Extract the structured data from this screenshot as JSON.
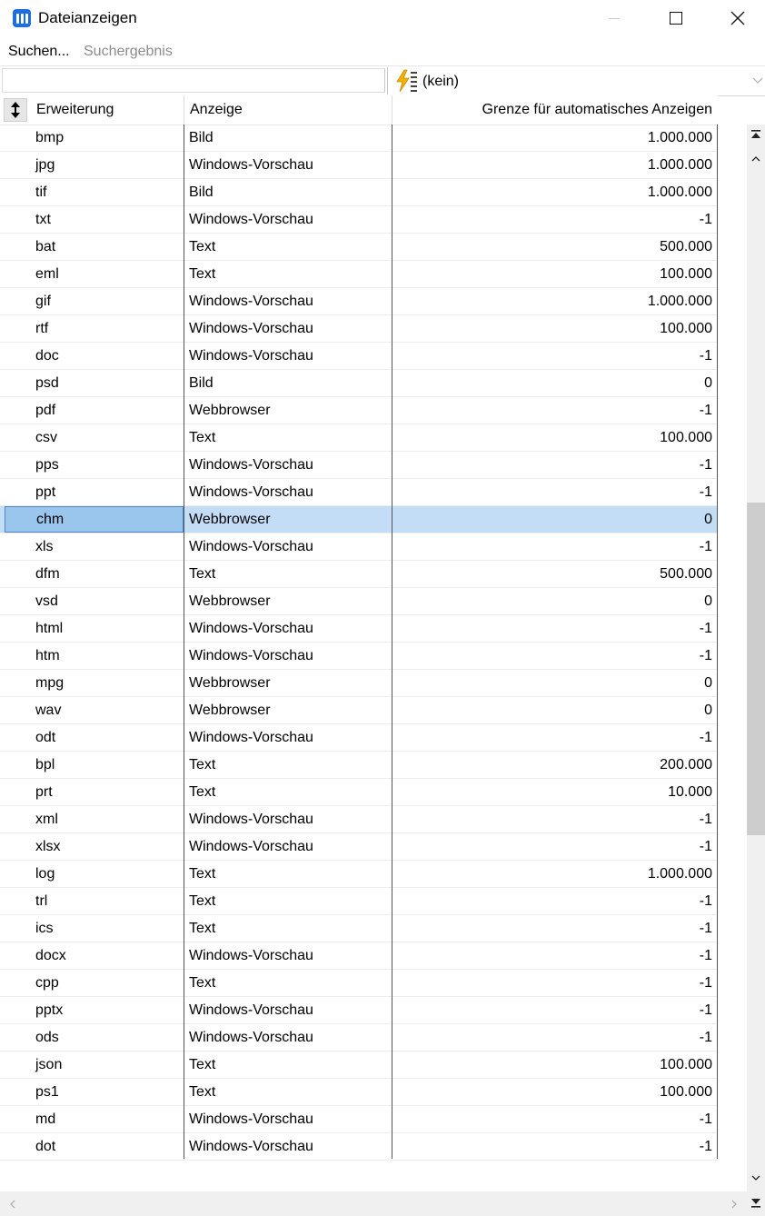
{
  "window": {
    "title": "Dateianzeigen"
  },
  "menu": {
    "search_label": "Suchen...",
    "results_label": "Suchergebnis"
  },
  "filter": {
    "input_value": "",
    "combo_value": "(kein)",
    "combo_icon": "lightning-list-icon"
  },
  "table": {
    "columns": {
      "extension": "Erweiterung",
      "view": "Anzeige",
      "limit": "Grenze für automatisches Anzeigen"
    },
    "selected_index": 14,
    "rows": [
      {
        "ext": "bmp",
        "view": "Bild",
        "limit": "1.000.000"
      },
      {
        "ext": "jpg",
        "view": "Windows-Vorschau",
        "limit": "1.000.000"
      },
      {
        "ext": "tif",
        "view": "Bild",
        "limit": "1.000.000"
      },
      {
        "ext": "txt",
        "view": "Windows-Vorschau",
        "limit": "-1"
      },
      {
        "ext": "bat",
        "view": "Text",
        "limit": "500.000"
      },
      {
        "ext": "eml",
        "view": "Text",
        "limit": "100.000"
      },
      {
        "ext": "gif",
        "view": "Windows-Vorschau",
        "limit": "1.000.000"
      },
      {
        "ext": "rtf",
        "view": "Windows-Vorschau",
        "limit": "100.000"
      },
      {
        "ext": "doc",
        "view": "Windows-Vorschau",
        "limit": "-1"
      },
      {
        "ext": "psd",
        "view": "Bild",
        "limit": "0"
      },
      {
        "ext": "pdf",
        "view": "Webbrowser",
        "limit": "-1"
      },
      {
        "ext": "csv",
        "view": "Text",
        "limit": "100.000"
      },
      {
        "ext": "pps",
        "view": "Windows-Vorschau",
        "limit": "-1"
      },
      {
        "ext": "ppt",
        "view": "Windows-Vorschau",
        "limit": "-1"
      },
      {
        "ext": "chm",
        "view": "Webbrowser",
        "limit": "0"
      },
      {
        "ext": "xls",
        "view": "Windows-Vorschau",
        "limit": "-1"
      },
      {
        "ext": "dfm",
        "view": "Text",
        "limit": "500.000"
      },
      {
        "ext": "vsd",
        "view": "Webbrowser",
        "limit": "0"
      },
      {
        "ext": "html",
        "view": "Windows-Vorschau",
        "limit": "-1"
      },
      {
        "ext": "htm",
        "view": "Windows-Vorschau",
        "limit": "-1"
      },
      {
        "ext": "mpg",
        "view": "Webbrowser",
        "limit": "0"
      },
      {
        "ext": "wav",
        "view": "Webbrowser",
        "limit": "0"
      },
      {
        "ext": "odt",
        "view": "Windows-Vorschau",
        "limit": "-1"
      },
      {
        "ext": "bpl",
        "view": "Text",
        "limit": "200.000"
      },
      {
        "ext": "prt",
        "view": "Text",
        "limit": "10.000"
      },
      {
        "ext": "xml",
        "view": "Windows-Vorschau",
        "limit": "-1"
      },
      {
        "ext": "xlsx",
        "view": "Windows-Vorschau",
        "limit": "-1"
      },
      {
        "ext": "log",
        "view": "Text",
        "limit": "1.000.000"
      },
      {
        "ext": "trl",
        "view": "Text",
        "limit": "-1"
      },
      {
        "ext": "ics",
        "view": "Text",
        "limit": "-1"
      },
      {
        "ext": "docx",
        "view": "Windows-Vorschau",
        "limit": "-1"
      },
      {
        "ext": "cpp",
        "view": "Text",
        "limit": "-1"
      },
      {
        "ext": "pptx",
        "view": "Windows-Vorschau",
        "limit": "-1"
      },
      {
        "ext": "ods",
        "view": "Windows-Vorschau",
        "limit": "-1"
      },
      {
        "ext": "json",
        "view": "Text",
        "limit": "100.000"
      },
      {
        "ext": "ps1",
        "view": "Text",
        "limit": "100.000"
      },
      {
        "ext": "md",
        "view": "Windows-Vorschau",
        "limit": "-1"
      },
      {
        "ext": "dot",
        "view": "Windows-Vorschau",
        "limit": "-1"
      }
    ]
  },
  "colors": {
    "selection": "#c4ddf6",
    "selected_cell": "#9ac6ee",
    "app_icon": "#1e6fd9"
  }
}
